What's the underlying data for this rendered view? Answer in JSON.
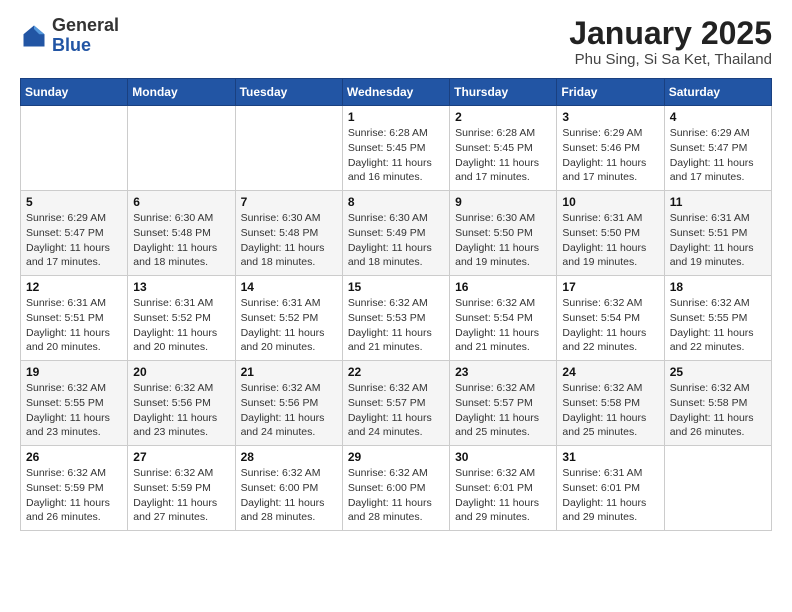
{
  "header": {
    "logo_general": "General",
    "logo_blue": "Blue",
    "month_title": "January 2025",
    "location": "Phu Sing, Si Sa Ket, Thailand"
  },
  "weekdays": [
    "Sunday",
    "Monday",
    "Tuesday",
    "Wednesday",
    "Thursday",
    "Friday",
    "Saturday"
  ],
  "weeks": [
    [
      {
        "day": "",
        "info": ""
      },
      {
        "day": "",
        "info": ""
      },
      {
        "day": "",
        "info": ""
      },
      {
        "day": "1",
        "info": "Sunrise: 6:28 AM\nSunset: 5:45 PM\nDaylight: 11 hours\nand 16 minutes."
      },
      {
        "day": "2",
        "info": "Sunrise: 6:28 AM\nSunset: 5:45 PM\nDaylight: 11 hours\nand 17 minutes."
      },
      {
        "day": "3",
        "info": "Sunrise: 6:29 AM\nSunset: 5:46 PM\nDaylight: 11 hours\nand 17 minutes."
      },
      {
        "day": "4",
        "info": "Sunrise: 6:29 AM\nSunset: 5:47 PM\nDaylight: 11 hours\nand 17 minutes."
      }
    ],
    [
      {
        "day": "5",
        "info": "Sunrise: 6:29 AM\nSunset: 5:47 PM\nDaylight: 11 hours\nand 17 minutes."
      },
      {
        "day": "6",
        "info": "Sunrise: 6:30 AM\nSunset: 5:48 PM\nDaylight: 11 hours\nand 18 minutes."
      },
      {
        "day": "7",
        "info": "Sunrise: 6:30 AM\nSunset: 5:48 PM\nDaylight: 11 hours\nand 18 minutes."
      },
      {
        "day": "8",
        "info": "Sunrise: 6:30 AM\nSunset: 5:49 PM\nDaylight: 11 hours\nand 18 minutes."
      },
      {
        "day": "9",
        "info": "Sunrise: 6:30 AM\nSunset: 5:50 PM\nDaylight: 11 hours\nand 19 minutes."
      },
      {
        "day": "10",
        "info": "Sunrise: 6:31 AM\nSunset: 5:50 PM\nDaylight: 11 hours\nand 19 minutes."
      },
      {
        "day": "11",
        "info": "Sunrise: 6:31 AM\nSunset: 5:51 PM\nDaylight: 11 hours\nand 19 minutes."
      }
    ],
    [
      {
        "day": "12",
        "info": "Sunrise: 6:31 AM\nSunset: 5:51 PM\nDaylight: 11 hours\nand 20 minutes."
      },
      {
        "day": "13",
        "info": "Sunrise: 6:31 AM\nSunset: 5:52 PM\nDaylight: 11 hours\nand 20 minutes."
      },
      {
        "day": "14",
        "info": "Sunrise: 6:31 AM\nSunset: 5:52 PM\nDaylight: 11 hours\nand 20 minutes."
      },
      {
        "day": "15",
        "info": "Sunrise: 6:32 AM\nSunset: 5:53 PM\nDaylight: 11 hours\nand 21 minutes."
      },
      {
        "day": "16",
        "info": "Sunrise: 6:32 AM\nSunset: 5:54 PM\nDaylight: 11 hours\nand 21 minutes."
      },
      {
        "day": "17",
        "info": "Sunrise: 6:32 AM\nSunset: 5:54 PM\nDaylight: 11 hours\nand 22 minutes."
      },
      {
        "day": "18",
        "info": "Sunrise: 6:32 AM\nSunset: 5:55 PM\nDaylight: 11 hours\nand 22 minutes."
      }
    ],
    [
      {
        "day": "19",
        "info": "Sunrise: 6:32 AM\nSunset: 5:55 PM\nDaylight: 11 hours\nand 23 minutes."
      },
      {
        "day": "20",
        "info": "Sunrise: 6:32 AM\nSunset: 5:56 PM\nDaylight: 11 hours\nand 23 minutes."
      },
      {
        "day": "21",
        "info": "Sunrise: 6:32 AM\nSunset: 5:56 PM\nDaylight: 11 hours\nand 24 minutes."
      },
      {
        "day": "22",
        "info": "Sunrise: 6:32 AM\nSunset: 5:57 PM\nDaylight: 11 hours\nand 24 minutes."
      },
      {
        "day": "23",
        "info": "Sunrise: 6:32 AM\nSunset: 5:57 PM\nDaylight: 11 hours\nand 25 minutes."
      },
      {
        "day": "24",
        "info": "Sunrise: 6:32 AM\nSunset: 5:58 PM\nDaylight: 11 hours\nand 25 minutes."
      },
      {
        "day": "25",
        "info": "Sunrise: 6:32 AM\nSunset: 5:58 PM\nDaylight: 11 hours\nand 26 minutes."
      }
    ],
    [
      {
        "day": "26",
        "info": "Sunrise: 6:32 AM\nSunset: 5:59 PM\nDaylight: 11 hours\nand 26 minutes."
      },
      {
        "day": "27",
        "info": "Sunrise: 6:32 AM\nSunset: 5:59 PM\nDaylight: 11 hours\nand 27 minutes."
      },
      {
        "day": "28",
        "info": "Sunrise: 6:32 AM\nSunset: 6:00 PM\nDaylight: 11 hours\nand 28 minutes."
      },
      {
        "day": "29",
        "info": "Sunrise: 6:32 AM\nSunset: 6:00 PM\nDaylight: 11 hours\nand 28 minutes."
      },
      {
        "day": "30",
        "info": "Sunrise: 6:32 AM\nSunset: 6:01 PM\nDaylight: 11 hours\nand 29 minutes."
      },
      {
        "day": "31",
        "info": "Sunrise: 6:31 AM\nSunset: 6:01 PM\nDaylight: 11 hours\nand 29 minutes."
      },
      {
        "day": "",
        "info": ""
      }
    ]
  ]
}
